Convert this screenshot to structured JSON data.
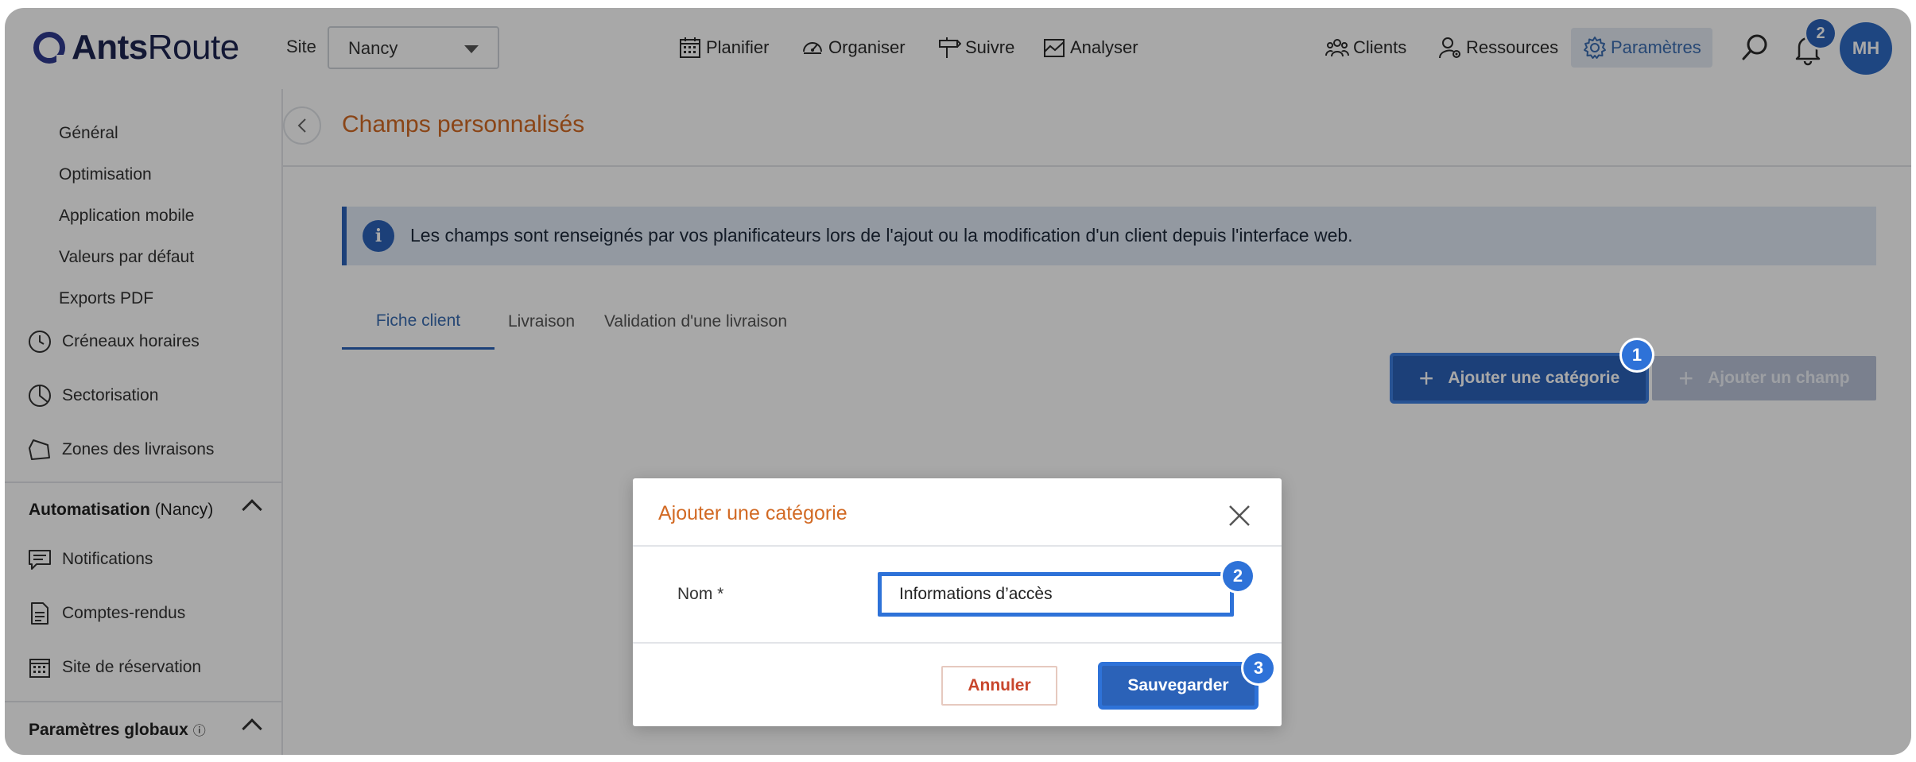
{
  "app": {
    "logo_bold": "Ants",
    "logo_light": "Route"
  },
  "header": {
    "site_label": "Site",
    "site_value": "Nancy",
    "nav": {
      "planifier": "Planifier",
      "organiser": "Organiser",
      "suivre": "Suivre",
      "analyser": "Analyser",
      "clients": "Clients",
      "ressources": "Ressources",
      "parametres": "Paramètres"
    },
    "notifications_count": "2",
    "avatar_initials": "MH"
  },
  "sidebar": {
    "subitems": [
      "Général",
      "Optimisation",
      "Application mobile",
      "Valeurs par défaut",
      "Exports PDF"
    ],
    "items": {
      "creneaux": "Créneaux horaires",
      "sectorisation": "Sectorisation",
      "zones": "Zones des livraisons",
      "notifications": "Notifications",
      "comptes_rendus": "Comptes-rendus",
      "site_reservation": "Site de réservation"
    },
    "automatisation_bold": "Automatisation",
    "automatisation_site": "(Nancy)",
    "parametres_globaux": "Paramètres globaux",
    "parametres_globaux_info": "ⓘ"
  },
  "main": {
    "title": "Champs personnalisés",
    "info_text": "Les champs sont renseignés par vos planificateurs lors de l'ajout ou la modification d'un client depuis l'interface web.",
    "tabs": [
      "Fiche client",
      "Livraison",
      "Validation d'une livraison"
    ],
    "add_category_label": "Ajouter une catégorie",
    "add_field_label": "Ajouter un champ"
  },
  "modal": {
    "title": "Ajouter une catégorie",
    "field_label": "Nom *",
    "field_value": "Informations d’accès",
    "cancel_label": "Annuler",
    "save_label": "Sauvegarder"
  },
  "steps": [
    "1",
    "2",
    "3"
  ],
  "colors": {
    "accent": "#2b62b8",
    "title_orange": "#d26a24",
    "cancel_red": "#c8462c"
  }
}
